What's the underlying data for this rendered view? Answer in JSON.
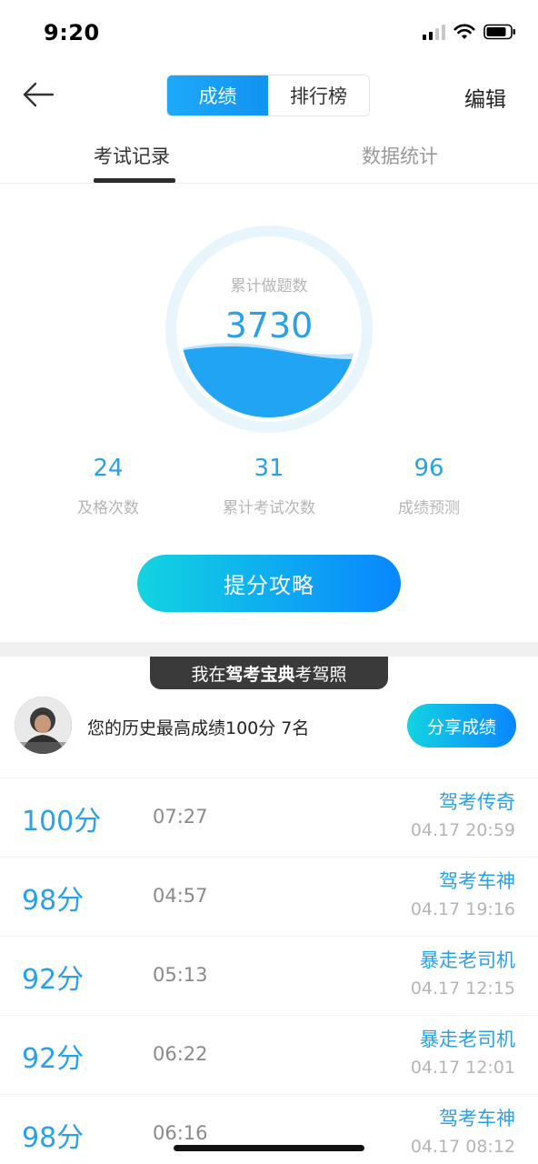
{
  "status_bar": {
    "time": "9:20"
  },
  "nav": {
    "segments": [
      "成绩",
      "排行榜"
    ],
    "active_segment": "成绩",
    "edit_label": "编辑",
    "accent_color": "#1a9ff5"
  },
  "tabs": [
    "考试记录",
    "数据统计"
  ],
  "summary": {
    "circle_label": "累计做题数",
    "circle_value": "3730"
  },
  "stats": [
    {
      "value": "24",
      "label": "及格次数"
    },
    {
      "value": "31",
      "label": "累计考试次数"
    },
    {
      "value": "96",
      "label": "成绩预测"
    }
  ],
  "cta_label": "提分攻略",
  "banner": {
    "prefix": "我在",
    "brand": "驾考宝典",
    "suffix": "考驾照"
  },
  "best": {
    "text": "您的历史最高成绩100分  7名",
    "share_label": "分享成绩"
  },
  "records": [
    {
      "score": "100分",
      "duration": "07:27",
      "title": "驾考传奇",
      "date": "04.17 20:59"
    },
    {
      "score": "98分",
      "duration": "04:57",
      "title": "驾考车神",
      "date": "04.17 19:16"
    },
    {
      "score": "92分",
      "duration": "05:13",
      "title": "暴走老司机",
      "date": "04.17 12:15"
    },
    {
      "score": "92分",
      "duration": "06:22",
      "title": "暴走老司机",
      "date": "04.17 12:01"
    },
    {
      "score": "98分",
      "duration": "06:16",
      "title": "驾考车神",
      "date": "04.17 08:12"
    }
  ]
}
